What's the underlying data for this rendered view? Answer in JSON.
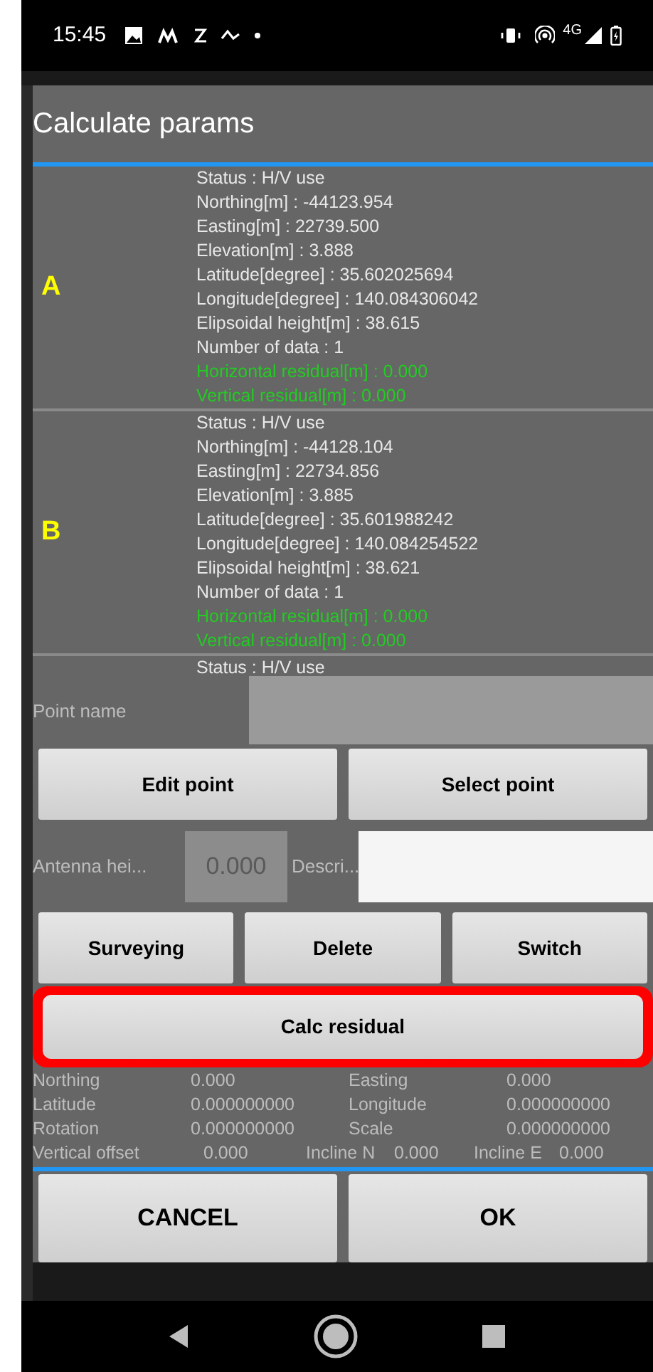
{
  "status_bar": {
    "time": "15:45",
    "network": "4G"
  },
  "dialog": {
    "title": "Calculate params",
    "points": [
      {
        "label": "A",
        "lines": [
          {
            "text": "Status : H/V use",
            "kind": "info"
          },
          {
            "text": "Northing[m] : -44123.954",
            "kind": "info"
          },
          {
            "text": "Easting[m] : 22739.500",
            "kind": "info"
          },
          {
            "text": "Elevation[m] : 3.888",
            "kind": "info"
          },
          {
            "text": "Latitude[degree] : 35.602025694",
            "kind": "info"
          },
          {
            "text": "Longitude[degree] : 140.084306042",
            "kind": "info"
          },
          {
            "text": "Elipsoidal height[m] : 38.615",
            "kind": "info"
          },
          {
            "text": "Number of data : 1",
            "kind": "info"
          },
          {
            "text": "Horizontal residual[m] : 0.000",
            "kind": "residual"
          },
          {
            "text": "Vertical residual[m] : 0.000",
            "kind": "residual"
          }
        ]
      },
      {
        "label": "B",
        "lines": [
          {
            "text": "Status : H/V use",
            "kind": "info"
          },
          {
            "text": "Northing[m] : -44128.104",
            "kind": "info"
          },
          {
            "text": "Easting[m] : 22734.856",
            "kind": "info"
          },
          {
            "text": "Elevation[m] : 3.885",
            "kind": "info"
          },
          {
            "text": "Latitude[degree] : 35.601988242",
            "kind": "info"
          },
          {
            "text": "Longitude[degree] : 140.084254522",
            "kind": "info"
          },
          {
            "text": "Elipsoidal height[m] : 38.621",
            "kind": "info"
          },
          {
            "text": "Number of data : 1",
            "kind": "info"
          },
          {
            "text": "Horizontal residual[m] : 0.000",
            "kind": "residual"
          },
          {
            "text": "Vertical residual[m] : 0.000",
            "kind": "residual"
          }
        ]
      },
      {
        "lines": [
          {
            "text": "Status : H/V use",
            "kind": "info"
          }
        ]
      }
    ],
    "point_name": {
      "label": "Point name"
    },
    "buttons_row_1": [
      "Edit point",
      "Select point"
    ],
    "antenna_height": {
      "label": "Antenna hei...",
      "placeholder": "0.000"
    },
    "description": {
      "label": "Descri..."
    },
    "buttons_row_2": [
      "Surveying",
      "Delete",
      "Switch"
    ],
    "calc_button": {
      "label": "Calc residual",
      "highlighted": true
    },
    "results": [
      [
        "Northing",
        "0.000",
        "Easting",
        "0.000"
      ],
      [
        "Latitude",
        "0.000000000",
        "Longitude",
        "0.000000000"
      ],
      [
        "Rotation",
        "0.000000000",
        "Scale",
        "0.000000000"
      ],
      [
        "Vertical offset",
        "0.000",
        "Incline N",
        "0.000",
        "Incline E",
        "0.000"
      ]
    ],
    "footer_buttons": [
      "CANCEL",
      "OK"
    ]
  }
}
